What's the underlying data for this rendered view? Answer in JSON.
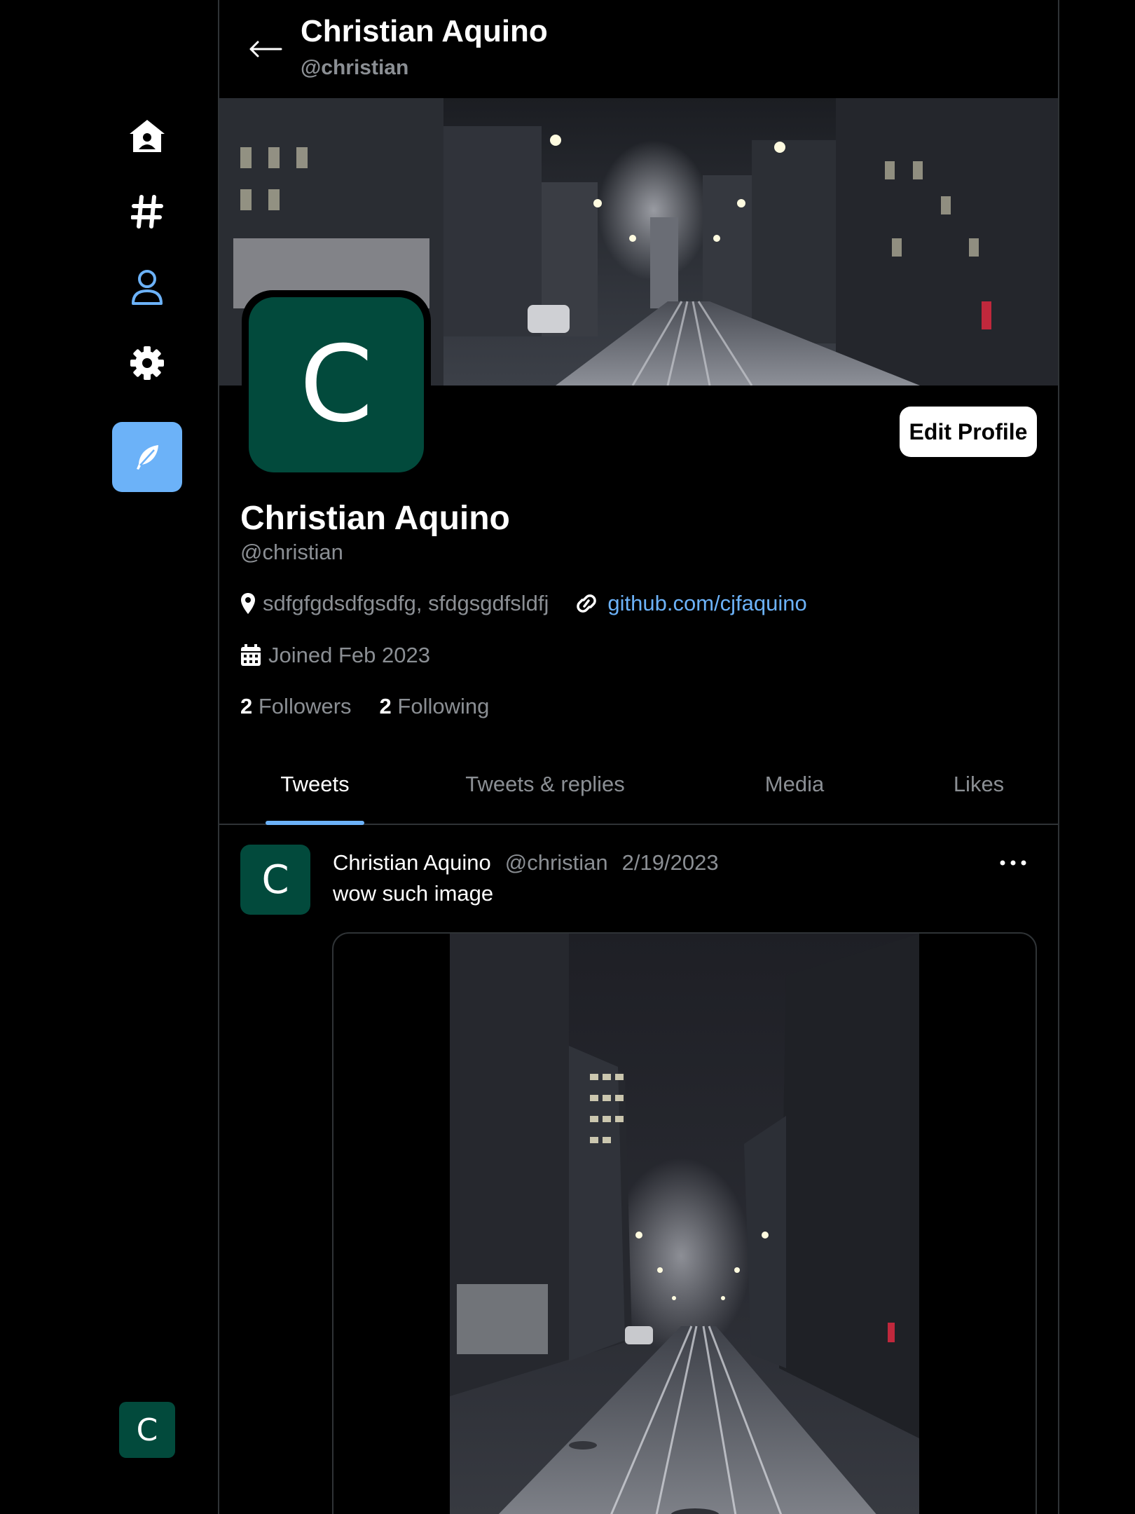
{
  "sidebar": {
    "nav": [
      {
        "name": "home",
        "icon": "home-icon"
      },
      {
        "name": "explore",
        "icon": "hashtag-icon"
      },
      {
        "name": "profile",
        "icon": "user-icon",
        "active": true
      },
      {
        "name": "settings",
        "icon": "gear-icon"
      }
    ],
    "compose_icon": "feather-icon",
    "avatar_letter": "C"
  },
  "header": {
    "title": "Christian Aquino",
    "handle": "@christian"
  },
  "profile": {
    "avatar_letter": "C",
    "edit_button": "Edit Profile",
    "name": "Christian Aquino",
    "handle": "@christian",
    "location": "sdfgfgdsdfgsdfg, sfdgsgdfsldfj",
    "website": "github.com/cjfaquino",
    "joined": "Joined Feb 2023",
    "followers_count": "2",
    "followers_label": "Followers",
    "following_count": "2",
    "following_label": "Following"
  },
  "tabs": [
    {
      "label": "Tweets",
      "active": true
    },
    {
      "label": "Tweets & replies"
    },
    {
      "label": "Media"
    },
    {
      "label": "Likes"
    }
  ],
  "tweet": {
    "avatar_letter": "C",
    "name": "Christian Aquino",
    "handle": "@christian",
    "date": "2/19/2023",
    "text": "wow such image"
  },
  "colors": {
    "accent": "#6cb2f8",
    "avatar_bg": "#024a3c",
    "muted_text": "#8b8f94",
    "border": "#2f3336"
  }
}
